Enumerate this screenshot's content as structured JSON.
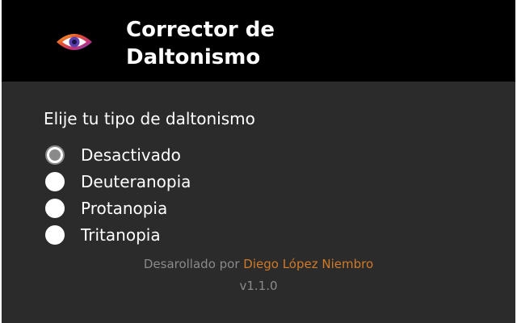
{
  "app": {
    "title_line1": "Corrector de",
    "title_line2": "Daltonismo",
    "logo_icon": "eye-icon"
  },
  "colors": {
    "header_bg": "#000000",
    "body_bg": "#2b2b2b",
    "accent": "#d07a28",
    "muted": "#8a8a8a"
  },
  "form": {
    "prompt": "Elije tu tipo de daltonismo",
    "selected": "Desactivado",
    "options": [
      {
        "label": "Desactivado",
        "checked": true
      },
      {
        "label": "Deuteranopia",
        "checked": false
      },
      {
        "label": "Protanopia",
        "checked": false
      },
      {
        "label": "Tritanopia",
        "checked": false
      }
    ]
  },
  "footer": {
    "credit_prefix": "Desarollado por",
    "author": "Diego López Niembro",
    "version": "v1.1.0"
  }
}
